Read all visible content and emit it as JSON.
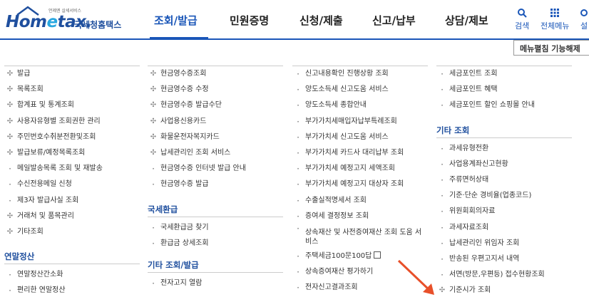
{
  "header": {
    "logo_tagline": "언제엔 살세서비스",
    "logo_text_pre": "Hom",
    "logo_text_e": "e",
    "logo_text_post": "tax.",
    "logo_sub": "국세청홈택스",
    "nav": [
      "조회/발급",
      "민원증명",
      "신청/제출",
      "신고/납부",
      "상담/제보"
    ],
    "active_nav": "조회/발급",
    "util": {
      "search_label": "검색",
      "allmenu_label": "전체메뉴",
      "partial_label": "설"
    }
  },
  "menu_lock_button": "메뉴펼침 기능해제",
  "columns": [
    {
      "items": [
        {
          "label": "발급",
          "marker": "cross"
        },
        {
          "label": "목록조회",
          "marker": "cross"
        },
        {
          "label": "합계표 및 통계조회",
          "marker": "cross"
        },
        {
          "label": "사용자유형별 조회권한 관리",
          "marker": "cross"
        },
        {
          "label": "주민번호수취분전환및조회",
          "marker": "cross"
        },
        {
          "label": "발급보류/예정목록조회",
          "marker": "cross"
        },
        {
          "label": "메일발송목록 조회 및 재발송",
          "marker": "dot"
        },
        {
          "label": "수신전용메일 신청",
          "marker": "dot"
        },
        {
          "label": "제3자 발급사실 조회",
          "marker": "dot"
        },
        {
          "label": "거래처 및 품목관리",
          "marker": "cross"
        },
        {
          "label": "기타조회",
          "marker": "cross"
        }
      ],
      "section": {
        "title": "연말정산",
        "items": [
          {
            "label": "연말정산간소화",
            "marker": "dot"
          },
          {
            "label": "편리한 연말정산",
            "marker": "dot"
          }
        ]
      }
    },
    {
      "items": [
        {
          "label": "현금영수증조회",
          "marker": "cross"
        },
        {
          "label": "현금영수증 수정",
          "marker": "cross"
        },
        {
          "label": "현금영수증 발급수단",
          "marker": "cross"
        },
        {
          "label": "사업용신용카드",
          "marker": "cross"
        },
        {
          "label": "화물운전자복지카드",
          "marker": "cross"
        },
        {
          "label": "납세관리인 조회 서비스",
          "marker": "cross"
        },
        {
          "label": "현금영수증 인터넷 발급 안내",
          "marker": "dot"
        },
        {
          "label": "현금영수증 발급",
          "marker": "dot"
        }
      ],
      "sections": [
        {
          "title": "국세환급",
          "items": [
            {
              "label": "국세환급금 찾기",
              "marker": "dot"
            },
            {
              "label": "환급금 상세조회",
              "marker": "dot"
            }
          ]
        },
        {
          "title": "기타 조회/발급",
          "items": [
            {
              "label": "전자고지 열람",
              "marker": "dot"
            }
          ]
        }
      ]
    },
    {
      "items": [
        {
          "label": "신고내용확인 진행상황 조회",
          "marker": "dot"
        },
        {
          "label": "양도소득세 신고도움 서비스",
          "marker": "dot"
        },
        {
          "label": "양도소득세 종합안내",
          "marker": "dot"
        },
        {
          "label": "부가가치세매입자납부특례조회",
          "marker": "dot"
        },
        {
          "label": "부가가치세 신고도움 서비스",
          "marker": "dot"
        },
        {
          "label": "부가가치세 카드사 대리납부 조회",
          "marker": "dot"
        },
        {
          "label": "부가가치세 예정고지 세액조회",
          "marker": "dot"
        },
        {
          "label": "부가가치세 예정고지 대상자 조회",
          "marker": "dot"
        },
        {
          "label": "수출실적명세서 조회",
          "marker": "dot"
        },
        {
          "label": "증여세 결정정보 조회",
          "marker": "dot"
        },
        {
          "label": "상속재산 및 사전증여재산 조회 도움 서비스",
          "marker": "dot",
          "two_line": true
        },
        {
          "label": "주택세금100문100답",
          "marker": "dot",
          "external": true
        },
        {
          "label": "상속증여재산 평가하기",
          "marker": "dot"
        },
        {
          "label": "전자신고결과조회",
          "marker": "dot"
        }
      ]
    },
    {
      "items": [
        {
          "label": "세금포인트 조회",
          "marker": "dot"
        },
        {
          "label": "세금포인트 혜택",
          "marker": "dot"
        },
        {
          "label": "세금포인트 할인 쇼핑몰 안내",
          "marker": "dot"
        }
      ],
      "section": {
        "title": "기타 조회",
        "items": [
          {
            "label": "과세유형전환",
            "marker": "dot"
          },
          {
            "label": "사업용계좌신고현황",
            "marker": "dot"
          },
          {
            "label": "주류면허상태",
            "marker": "dot"
          },
          {
            "label": "기준·단순 경비율(업종코드)",
            "marker": "dot"
          },
          {
            "label": "위원회회의자료",
            "marker": "dot"
          },
          {
            "label": "과세자료조회",
            "marker": "dot"
          },
          {
            "label": "납세관리인 위임자 조회",
            "marker": "dot"
          },
          {
            "label": "반송된 우편고지서 내역",
            "marker": "dot"
          },
          {
            "label": "서면(방문,우편등) 접수현황조회",
            "marker": "dot"
          },
          {
            "label": "기준시가 조회",
            "marker": "cross"
          }
        ]
      }
    }
  ],
  "colors": {
    "brand": "#1f4f9e",
    "accent": "#1a56b8",
    "annotation": "#e8502a"
  }
}
